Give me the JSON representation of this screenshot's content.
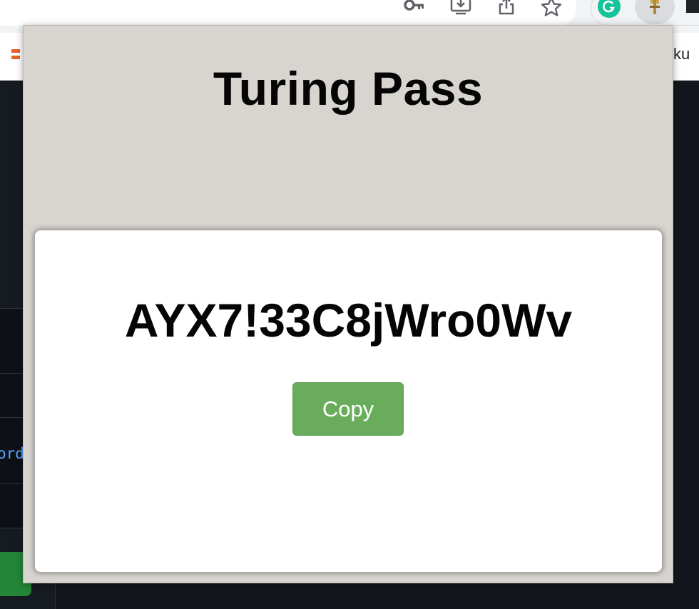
{
  "browser": {
    "toolbar_icons": [
      "key-icon",
      "install-app-icon",
      "share-icon",
      "star-icon"
    ],
    "extensions": [
      "grammarly-icon",
      "turing-pass-extension-icon",
      "puzzle-icon"
    ],
    "bookmark_partial_text": "ku"
  },
  "background_page": {
    "partial_link_text": "ord"
  },
  "popup": {
    "title": "Turing Pass",
    "password": "AYX7!33C8jWro0Wv",
    "copy_label": "Copy"
  },
  "colors": {
    "popup_bg": "#d8d5d0",
    "card_bg": "#ffffff",
    "copy_button": "#69ad5c",
    "grammarly": "#15c39a"
  }
}
